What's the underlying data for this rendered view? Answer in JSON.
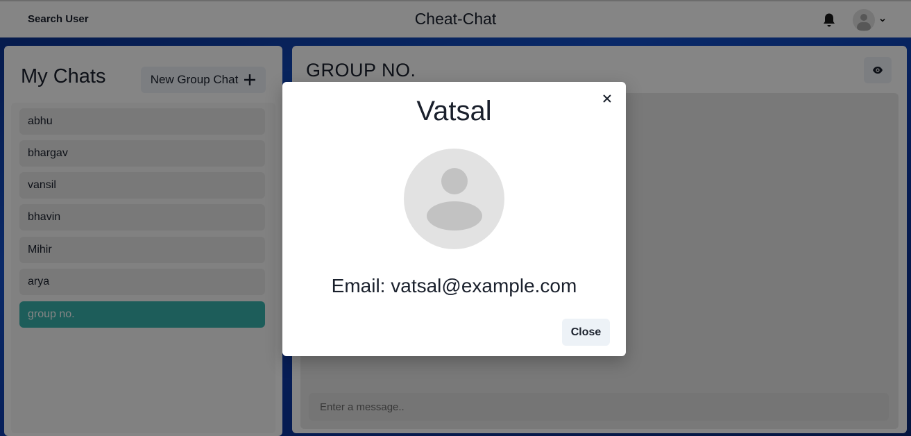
{
  "header": {
    "search_label": "Search User",
    "app_title": "Cheat-Chat"
  },
  "sidebar": {
    "title": "My Chats",
    "new_group_label": "New Group Chat",
    "chats": [
      {
        "label": "abhu",
        "active": false
      },
      {
        "label": "bhargav",
        "active": false
      },
      {
        "label": "vansil",
        "active": false
      },
      {
        "label": "bhavin",
        "active": false
      },
      {
        "label": "Mihir",
        "active": false
      },
      {
        "label": "arya",
        "active": false
      },
      {
        "label": "group no.",
        "active": true
      }
    ]
  },
  "chat": {
    "title": "GROUP NO.",
    "input_placeholder": "Enter a message.."
  },
  "modal": {
    "name": "Vatsal",
    "email": "Email: vatsal@example.com",
    "close_label": "Close"
  },
  "icons": {
    "bell": "bell-icon",
    "avatar": "user-avatar-icon",
    "chevron": "chevron-down-icon",
    "plus": "plus-icon",
    "eye": "eye-icon",
    "close": "close-icon"
  },
  "colors": {
    "accent": "#38b2ac",
    "background_gradient": "#1450c8"
  }
}
